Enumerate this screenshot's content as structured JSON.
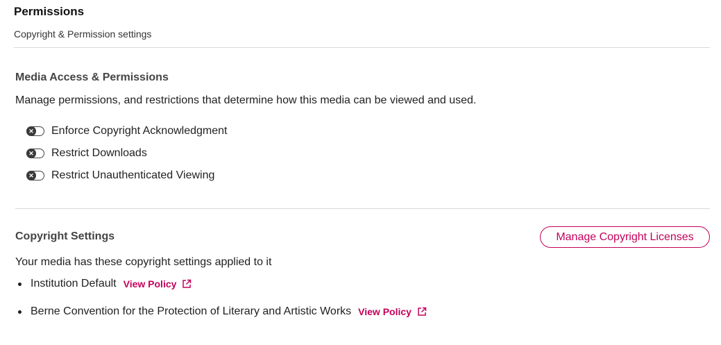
{
  "header": {
    "title": "Permissions",
    "subtitle": "Copyright & Permission settings"
  },
  "media_access": {
    "heading": "Media Access & Permissions",
    "description": "Manage permissions, and restrictions that determine how this media can be viewed and used.",
    "toggles": [
      {
        "label": "Enforce Copyright Acknowledgment",
        "state": "off"
      },
      {
        "label": "Restrict Downloads",
        "state": "off"
      },
      {
        "label": "Restrict Unauthenticated Viewing",
        "state": "off"
      }
    ]
  },
  "copyright": {
    "heading": "Copyright Settings",
    "manage_button": "Manage Copyright Licenses",
    "description": "Your media has these copyright settings applied to it",
    "policies": [
      {
        "name": "Institution Default",
        "link": "View Policy"
      },
      {
        "name": "Berne Convention for the Protection of Literary and Artistic Works",
        "link": "View Policy"
      }
    ]
  },
  "colors": {
    "accent": "#c4005a",
    "divider": "#d9d9d9",
    "text": "#1f1f1f"
  },
  "icons": {
    "toggle_off": "x-icon",
    "external_link": "external-link-icon"
  }
}
